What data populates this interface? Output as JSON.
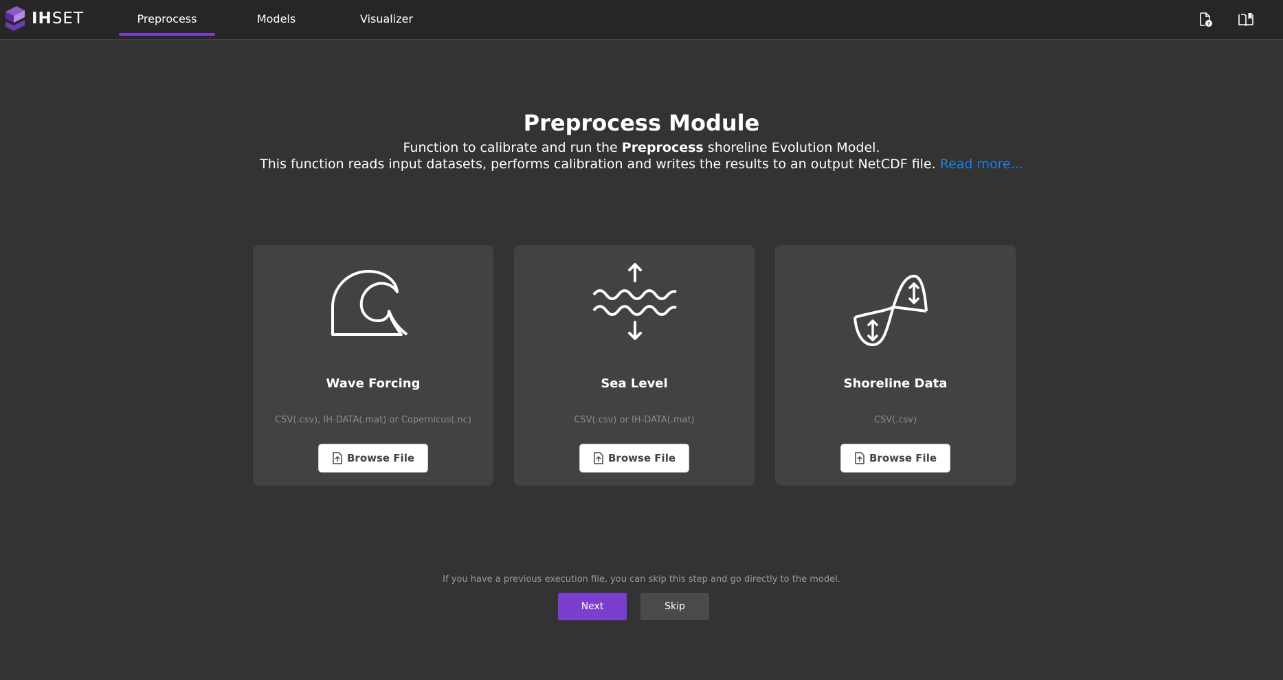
{
  "app": {
    "logo_text_bold": "IH",
    "logo_text_light": "SET",
    "brand_color": "#7b3fd0"
  },
  "nav": {
    "tabs": [
      {
        "label": "Preprocess",
        "active": true
      },
      {
        "label": "Models",
        "active": false
      },
      {
        "label": "Visualizer",
        "active": false
      }
    ],
    "right_icons": [
      "document-help-icon",
      "book-icon"
    ]
  },
  "header": {
    "title": "Preprocess Module",
    "line1_before": "Function to calibrate and run the ",
    "line1_bold": "Preprocess",
    "line1_after": " shoreline Evolution Model.",
    "line2": "This function reads input datasets, performs calibration and writes the results to an output NetCDF file. ",
    "read_more": "Read more..."
  },
  "cards": [
    {
      "title": "Wave Forcing",
      "formats": "CSV(.csv), IH-DATA(.mat) or Copernicus(.nc)",
      "button": "Browse File",
      "icon": "wave-icon"
    },
    {
      "title": "Sea Level",
      "formats": "CSV(.csv) or IH-DATA(.mat)",
      "button": "Browse File",
      "icon": "sea-level-icon"
    },
    {
      "title": "Shoreline Data",
      "formats": "CSV(.csv)",
      "button": "Browse File",
      "icon": "shoreline-icon"
    }
  ],
  "footer": {
    "hint": "If you have a previous execution file, you can skip this step and go directly to the model.",
    "next_label": "Next",
    "skip_label": "Skip"
  }
}
